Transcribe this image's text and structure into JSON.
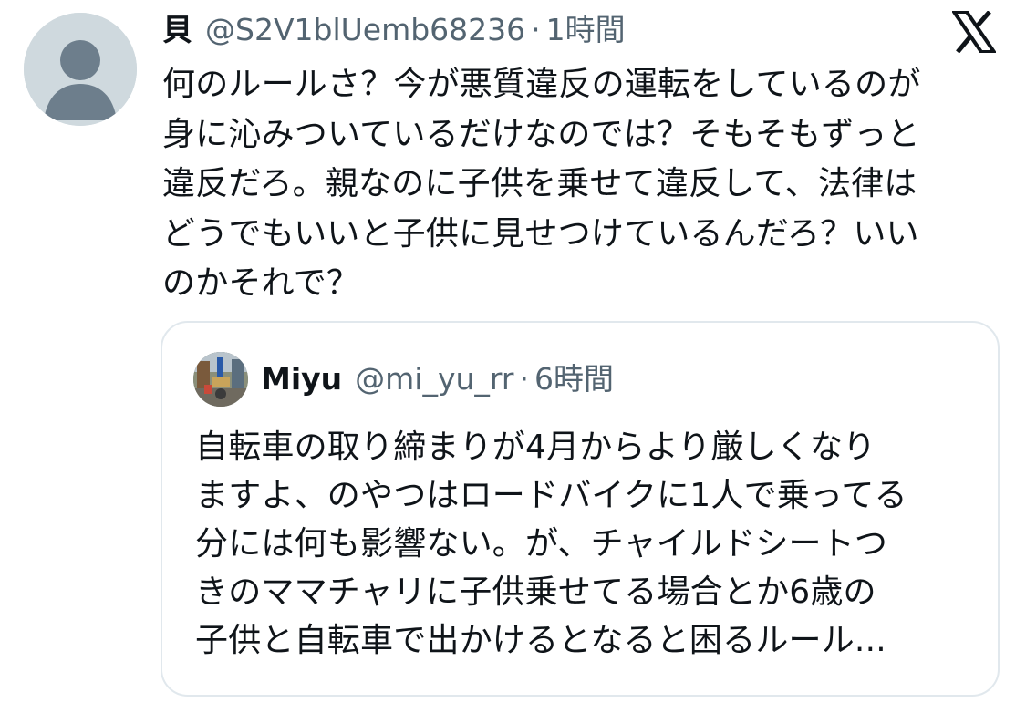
{
  "tweet": {
    "author_name": "貝",
    "author_handle": "@S2V1blUemb68236",
    "separator": "·",
    "time": "1時間",
    "avatar_icon": "default-profile-icon",
    "text_lines": [
      "何のルールさ？今が悪質違反の運転をしているのが",
      "身に沁みついているだけなのでは？そもそもずっと",
      "違反だろ。親なのに子供を乗せて違反して、法律は",
      "どうでもいいと子供に見せつけているんだろ？いい",
      "のかそれで？"
    ]
  },
  "brand": {
    "logo_icon": "x-logo-icon",
    "color": "#0f1419"
  },
  "quote": {
    "author_name": "Miyu",
    "author_handle": "@mi_yu_rr",
    "separator": "·",
    "time": "6時間",
    "avatar_icon": "street-photo-avatar",
    "text_lines": [
      "自転車の取り締まりが4月からより厳しくなり",
      "ますよ、のやつはロードバイクに1人で乗ってる",
      "分には何も影響ない。が、チャイルドシートつ",
      "きのママチャリに子供乗せてる場合とか6歳の",
      "子供と自転車で出かけるとなると困るルール..."
    ]
  },
  "colors": {
    "text_primary": "#0f1419",
    "text_secondary": "#536471",
    "border": "#e1e8ed",
    "avatar_placeholder": "#cfd9de"
  }
}
